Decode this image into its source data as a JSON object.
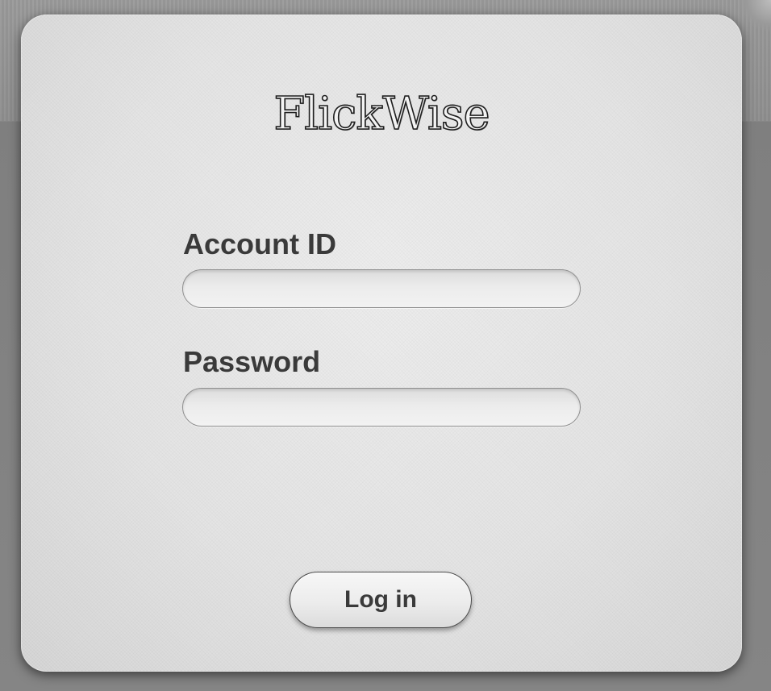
{
  "app": {
    "logo_text": "FlickWise"
  },
  "form": {
    "account_id_label": "Account ID",
    "account_id_value": "",
    "password_label": "Password",
    "password_value": "",
    "login_label": "Log in"
  },
  "colors": {
    "backdrop": "#8a8a8a",
    "card_background": "#e6e6e6",
    "label_text": "#3a3a3a",
    "input_border": "#8f8f8f",
    "logo_outline": "#1e1e1e"
  }
}
